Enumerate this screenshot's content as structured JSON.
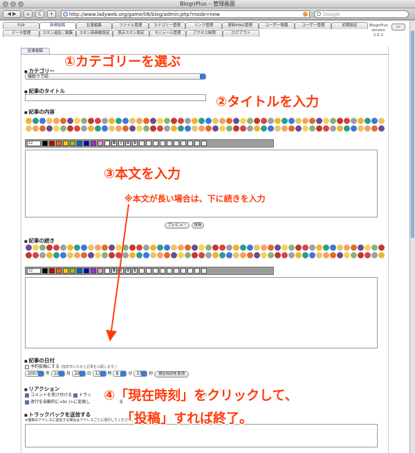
{
  "window": {
    "title": "BlognPlus – 管理画面"
  },
  "browser": {
    "back": "◀",
    "forward": "▶",
    "home": "⌂",
    "reload": "C",
    "add": "+",
    "url": "http://www.ladyweb.org/game/08/blog/admin.php?mode=new",
    "search_placeholder": "Google"
  },
  "nav": {
    "row1": [
      "TOP",
      "新規投稿",
      "記事編集",
      "ファイル管理",
      "カテゴリー管理",
      "リンク管理",
      "更新PING管理",
      "ユーザー情報",
      "ユーザー管理",
      "初期設定"
    ],
    "row2": [
      "データ管理",
      "スキン追加／編集",
      "スキン用画像設定",
      "表示スキン設定",
      "モジュール管理",
      "アクセス制限",
      "ログアウト"
    ],
    "active": "新規投稿",
    "brand_name": "BlognPlus",
    "brand_version_label": "version",
    "brand_version": "2.5.1"
  },
  "form": {
    "subtab": "記事投稿",
    "category_label": "カテゴリー",
    "category_value": "撮影ウラ話",
    "title_label": "記事のタイトル",
    "body_label": "記事の内容",
    "font_size": "12",
    "format_buttons": [
      "B",
      "I",
      "U",
      "S"
    ],
    "preview_button": "プレビュー",
    "post_button": "投稿",
    "more_label": "記事の続き",
    "date_label": "記事の日付",
    "reserve_label": "予約投稿にする",
    "reserve_note": "(指定日になると記事を公開します。)",
    "year": "2007",
    "year_unit": "年",
    "month": "10",
    "month_unit": "月",
    "day": "29",
    "day_unit": "日",
    "hour": "13",
    "hour_unit": "時",
    "minute": "8",
    "minute_unit": "分",
    "second": "37",
    "second_unit": "秒",
    "now_button": "現在時刻を取得",
    "reaction_label": "リアクション",
    "reaction_opts": [
      "コメントを受け付ける",
      "トラッ",
      "改行を自動的に<br />に変換し"
    ],
    "reaction_tail": [
      "を受",
      "る"
    ],
    "trackback_label": "トラックバックを送信する",
    "trackback_note": "※複数のアドレスに送信する場合はアドレスごとに改行してください。"
  },
  "annotations": {
    "step1": "①カテゴリーを選ぶ",
    "step2": "②タイトルを入力",
    "step3": "③本文を入力",
    "step3_note": "※本文が長い場合は、下に続きを入力",
    "step4_line1": "④「現在時刻」をクリックして、",
    "step4_line2": "「投稿」すれば終了。"
  },
  "colors": {
    "annotation": "#ff3b0a",
    "accent": "#3b78d8"
  }
}
